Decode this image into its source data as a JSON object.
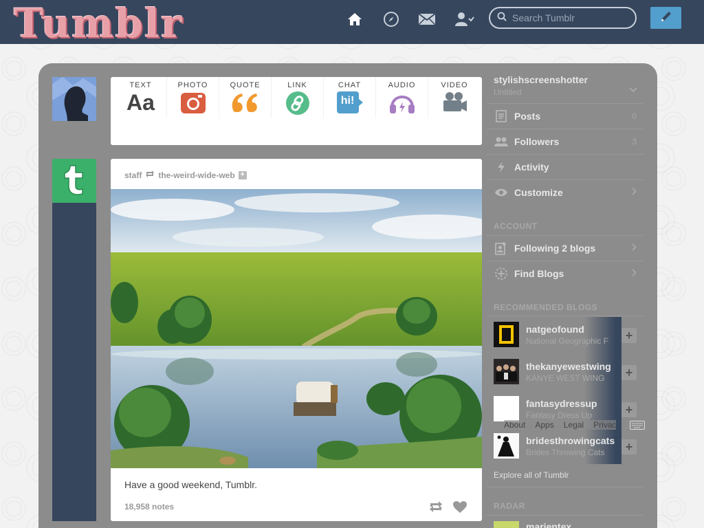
{
  "header": {
    "logo": "Tumblr",
    "search_placeholder": "Search Tumblr",
    "nav": [
      "home-icon",
      "explore-compass-icon",
      "inbox-mail-icon",
      "account-icon"
    ],
    "compose_icon": "pencil-icon"
  },
  "post_form": {
    "items": [
      {
        "label": "TEXT",
        "icon": "text-icon",
        "color": "#444444"
      },
      {
        "label": "PHOTO",
        "icon": "camera-icon",
        "color": "#d95e40"
      },
      {
        "label": "QUOTE",
        "icon": "quote-icon",
        "color": "#f2992e"
      },
      {
        "label": "LINK",
        "icon": "link-icon",
        "color": "#56bc8a"
      },
      {
        "label": "CHAT",
        "icon": "chat-icon",
        "color": "#529ecc"
      },
      {
        "label": "AUDIO",
        "icon": "headphones-icon",
        "color": "#a77dc2"
      },
      {
        "label": "VIDEO",
        "icon": "video-camera-icon",
        "color": "#748089"
      }
    ],
    "text_glyph": "Aa",
    "chat_glyph": "hi!"
  },
  "post": {
    "author": "staff",
    "reblogged_from": "the-weird-wide-web",
    "caption": "Have a good weekend, Tumblr.",
    "notes": "18,958 notes"
  },
  "sidebar": {
    "blog_name": "stylishscreenshotter",
    "blog_title": "Untitled",
    "rows": [
      {
        "label": "Posts",
        "count": "0",
        "icon": "posts-icon"
      },
      {
        "label": "Followers",
        "count": "3",
        "icon": "followers-icon"
      },
      {
        "label": "Activity",
        "count": "",
        "icon": "activity-icon"
      },
      {
        "label": "Customize",
        "count": "",
        "icon": "eye-icon"
      }
    ],
    "account_heading": "ACCOUNT",
    "account_rows": [
      {
        "label": "Following 2 blogs",
        "icon": "following-icon"
      },
      {
        "label": "Find Blogs",
        "icon": "find-blogs-icon"
      }
    ],
    "recommended_heading": "RECOMMENDED BLOGS",
    "recommended": [
      {
        "name": "natgeofound",
        "subtitle": "National Geographic F"
      },
      {
        "name": "thekanyewestwing",
        "subtitle": "KANYE WEST WING"
      },
      {
        "name": "fantasydressup",
        "subtitle": "Fantasy Dress Up"
      },
      {
        "name": "bridesthrowingcats",
        "subtitle": "Brides Throwing Cats"
      }
    ],
    "footer_links": [
      "About",
      "Apps",
      "Legal",
      "Privac"
    ],
    "explore_link": "Explore all of Tumblr",
    "radar_heading": "RADAR",
    "radar_blog": "marientex"
  },
  "colors": {
    "header_bg": "#36465d",
    "compose_bg": "#529ecc",
    "staff_avatar": "#3ab06a"
  }
}
